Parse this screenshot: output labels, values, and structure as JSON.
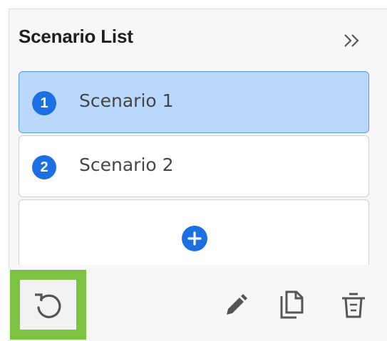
{
  "panel": {
    "title": "Scenario List",
    "collapse_icon": "double-chevron-right-icon"
  },
  "scenarios": [
    {
      "number": "1",
      "label": "Scenario 1",
      "selected": true
    },
    {
      "number": "2",
      "label": "Scenario 2",
      "selected": false
    }
  ],
  "add_item": {
    "icon": "plus-circle-icon"
  },
  "toolbar": {
    "reset_icon": "reset-icon",
    "edit_icon": "pencil-icon",
    "copy_icon": "copy-icon",
    "delete_icon": "trash-icon"
  },
  "colors": {
    "accent": "#1d6fe4",
    "selected_background": "#b9d8fb",
    "selected_border": "#5a9ce8",
    "highlight": "#7dc242",
    "icon_gray": "#555555"
  }
}
